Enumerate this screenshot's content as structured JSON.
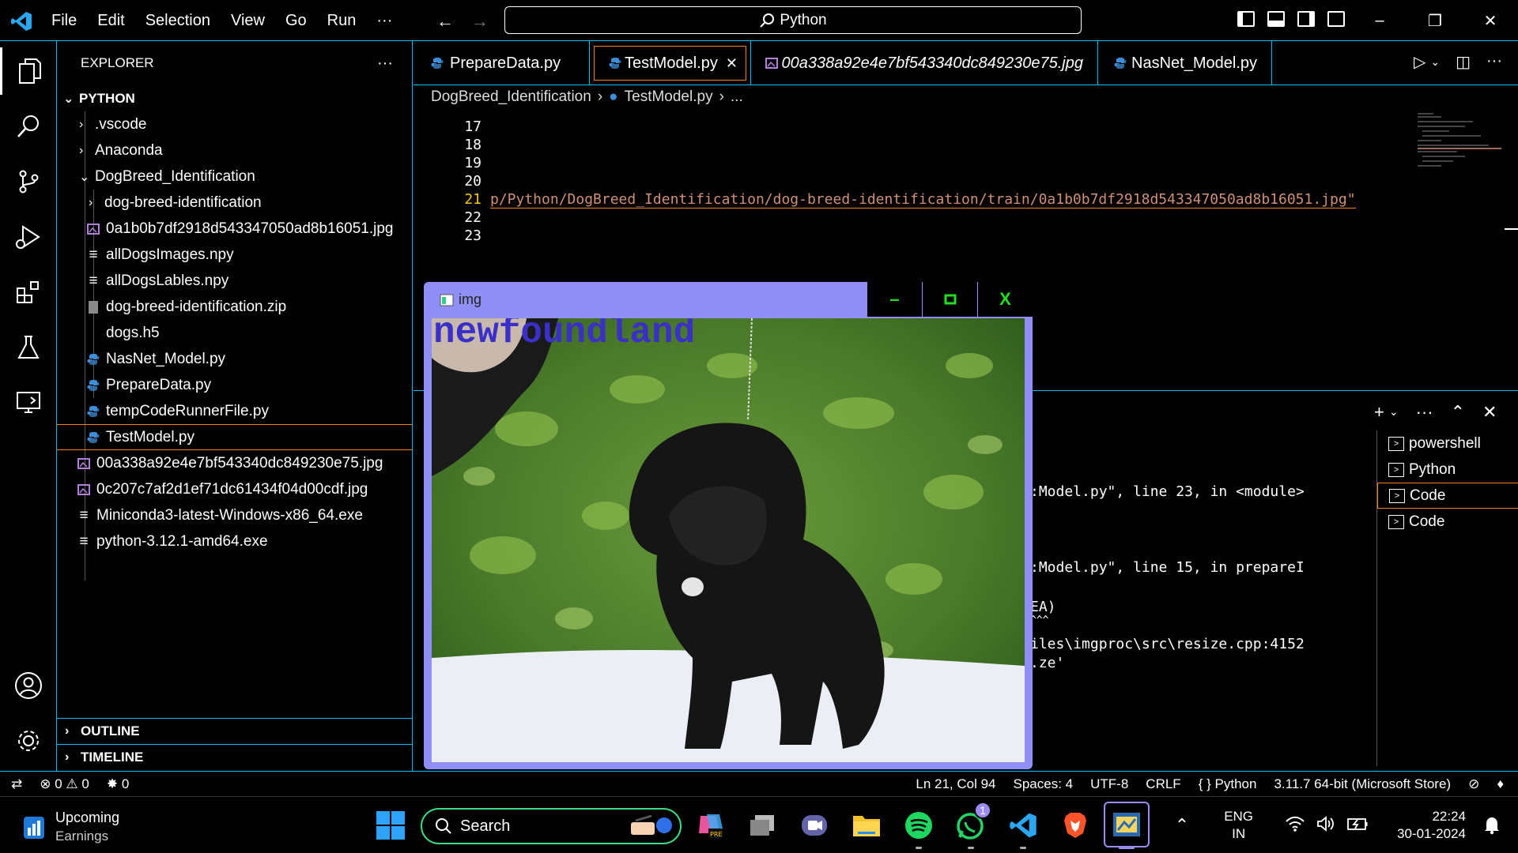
{
  "titlebar": {
    "menu": [
      "File",
      "Edit",
      "Selection",
      "View",
      "Go",
      "Run",
      "···"
    ],
    "search": "Python"
  },
  "sidebar": {
    "header": "EXPLORER",
    "more": "···",
    "root": "PYTHON",
    "items": [
      {
        "label": ".vscode",
        "kind": "folder-collapsed"
      },
      {
        "label": "Anaconda",
        "kind": "folder-collapsed"
      },
      {
        "label": "DogBreed_Identification",
        "kind": "folder-expanded"
      },
      {
        "label": "dog-breed-identification",
        "kind": "folder-collapsed"
      },
      {
        "label": "0a1b0b7df2918d543347050ad8b16051.jpg",
        "kind": "image"
      },
      {
        "label": "allDogsImages.npy",
        "kind": "text"
      },
      {
        "label": "allDogsLables.npy",
        "kind": "text"
      },
      {
        "label": "dog-breed-identification.zip",
        "kind": "zip"
      },
      {
        "label": "dogs.h5",
        "kind": "file"
      },
      {
        "label": "NasNet_Model.py",
        "kind": "python"
      },
      {
        "label": "PrepareData.py",
        "kind": "python"
      },
      {
        "label": "tempCodeRunnerFile.py",
        "kind": "python"
      },
      {
        "label": "TestModel.py",
        "kind": "python"
      },
      {
        "label": "00a338a92e4e7bf543340dc849230e75.jpg",
        "kind": "image"
      },
      {
        "label": "0c207c7af2d1ef71dc61434f04d00cdf.jpg",
        "kind": "image"
      },
      {
        "label": "Miniconda3-latest-Windows-x86_64.exe",
        "kind": "text"
      },
      {
        "label": "python-3.12.1-amd64.exe",
        "kind": "text"
      }
    ],
    "outline": "OUTLINE",
    "timeline": "TIMELINE"
  },
  "tabs": [
    {
      "label": "PrepareData.py"
    },
    {
      "label": "TestModel.py",
      "close": "✕"
    },
    {
      "label": "00a338a92e4e7bf543340dc849230e75.jpg"
    },
    {
      "label": "NasNet_Model.py"
    }
  ],
  "breadcrumb": {
    "folder": "DogBreed_Identification",
    "file": "TestModel.py",
    "tail": "..."
  },
  "editor": {
    "line_numbers": [
      "17",
      "18",
      "19",
      "20",
      "21",
      "22",
      "23"
    ],
    "line21": "p/Python/DogBreed_Identification/dog-breed-identification/train/0a1b0b7df2918d543347050ad8b16051.jpg\""
  },
  "terminal": {
    "lines": [
      ":Model.py\", line 23, in <module>",
      ":Model.py\", line 15, in prepareI",
      "EA)",
      "^^^",
      "iles\\imgproc\\src\\resize.cpp:4152",
      ".ze'"
    ],
    "list": [
      "powershell",
      "Python",
      "Code",
      "Code"
    ]
  },
  "image_window": {
    "title": "img",
    "label": "newfoundland",
    "minimize": "–",
    "close": "X"
  },
  "statusbar": {
    "errors": "0",
    "warnings": "0",
    "ports": "0",
    "position": "Ln 21, Col 94",
    "spaces": "Spaces: 4",
    "encoding": "UTF-8",
    "eol": "CRLF",
    "language": "Python",
    "interpreter": "3.11.7 64-bit (Microsoft Store)"
  },
  "taskbar": {
    "weather_title": "Upcoming",
    "weather_sub": "Earnings",
    "search": "Search",
    "whatsapp_badge": "1",
    "lang1": "ENG",
    "lang2": "IN",
    "time": "22:24",
    "date": "30-01-2024"
  },
  "colors": {
    "accent_border": "#00bfff",
    "active_outline": "#f38518",
    "string": "#ce9178",
    "image_frame": "#8f8ff5",
    "label_text": "#3a2fc8"
  }
}
